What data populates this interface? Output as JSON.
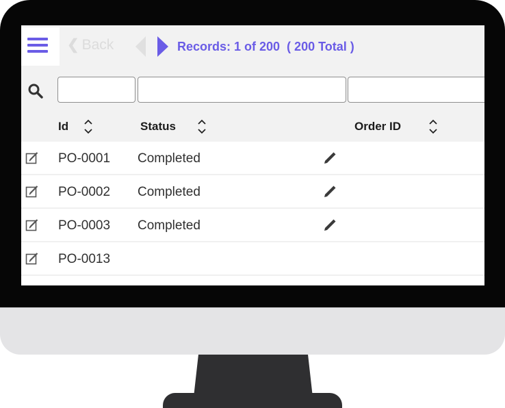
{
  "toolbar": {
    "menu_icon": "hamburger-menu-icon",
    "back_label": "Back",
    "back_icon": "chevron-left-icon",
    "prev_icon": "triangle-left-icon",
    "next_icon": "triangle-right-icon",
    "records_label": "Records: 1 of 200  ( 200 Total )",
    "accent_color": "#6a5ce6"
  },
  "filters": {
    "search_icon": "search-icon",
    "values": [
      "",
      "",
      ""
    ]
  },
  "table": {
    "columns": [
      {
        "label": "Id",
        "sortable": true
      },
      {
        "label": "Status",
        "sortable": true
      },
      {
        "label": "Order ID",
        "sortable": true
      }
    ],
    "rows": [
      {
        "id": "PO-0001",
        "status": "Completed",
        "order_id": "",
        "has_pencil": true
      },
      {
        "id": "PO-0002",
        "status": "Completed",
        "order_id": "",
        "has_pencil": true
      },
      {
        "id": "PO-0003",
        "status": "Completed",
        "order_id": "",
        "has_pencil": true
      },
      {
        "id": "PO-0013",
        "status": "",
        "order_id": "",
        "has_pencil": false
      },
      {
        "id": "",
        "status": "",
        "order_id": "",
        "has_pencil": false
      }
    ]
  }
}
